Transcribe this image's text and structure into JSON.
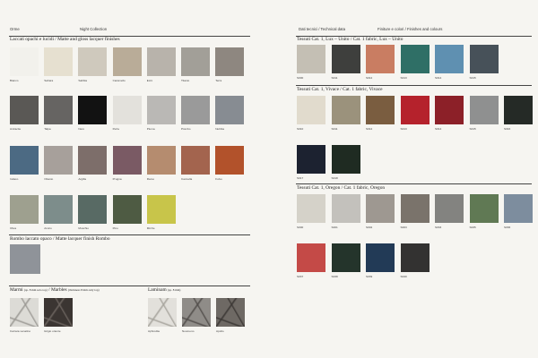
{
  "left": {
    "header_left": "Orme",
    "header_right": "Night Collection",
    "lacquer": {
      "title": "Laccati opachi e lucidi / Matte and gloss lacquer finishes",
      "rows": [
        [
          {
            "name": "Bianco",
            "color": "#f2f1ec"
          },
          {
            "name": "Sahara",
            "color": "#e6e0d0"
          },
          {
            "name": "Sabbia",
            "color": "#cfc9bd"
          },
          {
            "name": "Caramello",
            "color": "#b9ac98"
          },
          {
            "name": "Ecrù",
            "color": "#b8b3ab"
          },
          {
            "name": "Titanio",
            "color": "#a29f98"
          },
          {
            "name": "Terra",
            "color": "#8e8780"
          }
        ],
        [
          {
            "name": "Antracite",
            "color": "#5a5855"
          },
          {
            "name": "Talpa",
            "color": "#666462"
          },
          {
            "name": "Nero",
            "color": "#121212"
          },
          {
            "name": "Perla",
            "color": "#e3e1dc"
          },
          {
            "name": "Piuma",
            "color": "#bab8b5"
          },
          {
            "name": "Piombo",
            "color": "#9a9a9a"
          },
          {
            "name": "Nebbia",
            "color": "#878c92"
          }
        ],
        [
          {
            "name": "Indaco",
            "color": "#4c6a83"
          },
          {
            "name": "Ottanio",
            "color": "#a7a09b"
          },
          {
            "name": "Argilla",
            "color": "#7d6e6a"
          },
          {
            "name": "Prugna",
            "color": "#7a5a64"
          },
          {
            "name": "Ramo",
            "color": "#b58c6f"
          },
          {
            "name": "Cannella",
            "color": "#a3644e"
          },
          {
            "name": "Fulvo",
            "color": "#b2522b"
          }
        ],
        [
          {
            "name": "Oliva",
            "color": "#9ea08f"
          },
          {
            "name": "Amico",
            "color": "#7d8d8b"
          },
          {
            "name": "Muschio",
            "color": "#586a64"
          },
          {
            "name": "Pino",
            "color": "#4e5b43"
          },
          {
            "name": "Mizzle",
            "color": "#c8c54a"
          }
        ]
      ]
    },
    "rombo": {
      "title": "Rombo laccato opaco / Matte lacquer finish Rombo",
      "color": "#8f9399"
    },
    "marble": {
      "title": "Marmi",
      "title_note": "(sp. 8 mm solo top)",
      "title2": "/ Marbles",
      "title2_note": "(thickness 8 mm only top)",
      "items": [
        {
          "name": "Carrara venatino",
          "base": "#dcdbd6",
          "vein": "#9a9893"
        },
        {
          "name": "Grigio oriente",
          "base": "#3b3532",
          "vein": "#6d6560"
        }
      ]
    },
    "laminam": {
      "title": "Laminam",
      "title_note": "(sp. 8 mm)",
      "items": [
        {
          "name": "Aphrodite",
          "base": "#e2e0db",
          "vein": "#a6a39c"
        },
        {
          "name": "Noumeno",
          "base": "#8f8c88",
          "vein": "#504c49"
        },
        {
          "name": "Apollo",
          "base": "#6e6964",
          "vein": "#3a3633"
        }
      ]
    }
  },
  "right": {
    "header_left": "Dati tecnici / Technical data",
    "header_right": "Finiture e colori / Finishes and colours",
    "lux": {
      "title": "Tessuti Cat. 1, Lux – Unito / Cat. 1 fabric, Lux – Unito",
      "items": [
        {
          "code": "S000",
          "color": "#c4bfb4"
        },
        {
          "code": "S011",
          "color": "#3e3f3d"
        },
        {
          "code": "S012",
          "color": "#c97d62"
        },
        {
          "code": "S013",
          "color": "#2f6f66"
        },
        {
          "code": "S014",
          "color": "#5f90b1"
        },
        {
          "code": "S015",
          "color": "#475159"
        }
      ]
    },
    "vivace": {
      "title": "Tessuti Cat. 1, Vivace / Cat. 1 fabric, Vivace",
      "rows": [
        [
          {
            "code": "S010",
            "color": "#e1dbcd"
          },
          {
            "code": "S011",
            "color": "#9b927c"
          },
          {
            "code": "S012",
            "color": "#7a5d40"
          },
          {
            "code": "S013",
            "color": "#b5222c"
          },
          {
            "code": "S014",
            "color": "#8c2028"
          },
          {
            "code": "S015",
            "color": "#8f9090"
          },
          {
            "code": "S016",
            "color": "#252a26"
          }
        ],
        [
          {
            "code": "S017",
            "color": "#1c2230"
          },
          {
            "code": "S018",
            "color": "#1f2b22"
          }
        ]
      ]
    },
    "oregon": {
      "title": "Tessuti Cat. 1, Oregon / Cat. 1 fabric, Oregon",
      "rows": [
        [
          {
            "code": "S000",
            "color": "#d5d2c9"
          },
          {
            "code": "S001",
            "color": "#c3c1bc"
          },
          {
            "code": "S002",
            "color": "#9e9891"
          },
          {
            "code": "S003",
            "color": "#7a736b"
          },
          {
            "code": "S033",
            "color": "#838380"
          },
          {
            "code": "S035",
            "color": "#607954"
          },
          {
            "code": "S036",
            "color": "#7d8d9e"
          }
        ],
        [
          {
            "code": "S037",
            "color": "#c44a47"
          },
          {
            "code": "S038",
            "color": "#24342b"
          },
          {
            "code": "S039",
            "color": "#223a56"
          },
          {
            "code": "S040",
            "color": "#333231"
          }
        ]
      ]
    }
  }
}
